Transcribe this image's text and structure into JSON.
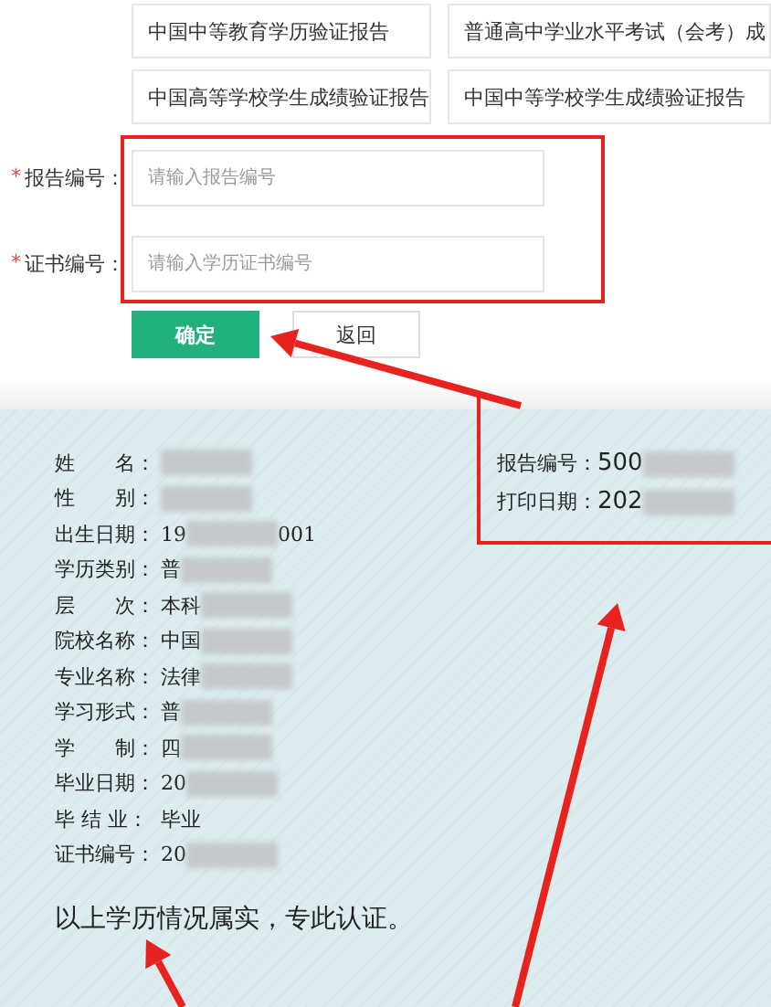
{
  "report_types": [
    {
      "label": "中国中等教育学历验证报告"
    },
    {
      "label": "普通高中学业水平考试（会考）成"
    },
    {
      "label": "中国高等学校学生成绩验证报告"
    },
    {
      "label": "中国中等学校学生成绩验证报告"
    }
  ],
  "fields": [
    {
      "label": "报告编号：",
      "placeholder": "请输入报告编号",
      "marker": "*"
    },
    {
      "label": "证书编号：",
      "placeholder": "请输入学历证书编号",
      "marker": "*"
    }
  ],
  "buttons": [
    {
      "label": "确定",
      "kind": "primary"
    },
    {
      "label": "返回",
      "kind": "default"
    }
  ],
  "certificate": {
    "header": [
      {
        "label": "报告编号：",
        "value": "500",
        "redacted": true
      },
      {
        "label": "打印日期：",
        "value": "202",
        "redacted": true
      }
    ],
    "rows": [
      {
        "label": "姓　　名：",
        "redacted": true
      },
      {
        "label": "性　　别：",
        "redacted": true
      },
      {
        "label": "出生日期：",
        "value": "19",
        "redacted": true,
        "value_end": "001"
      },
      {
        "label": "学历类别：",
        "value": "普",
        "redacted": true
      },
      {
        "label": "层　　次：",
        "value": "本科",
        "redacted": true
      },
      {
        "label": "院校名称：",
        "value": "中国",
        "redacted": true
      },
      {
        "label": "专业名称：",
        "value": "法律",
        "redacted": true
      },
      {
        "label": "学习形式：",
        "value": "普",
        "redacted": true
      },
      {
        "label": "学　　制：",
        "value": "四",
        "redacted": true
      },
      {
        "label": "毕业日期：",
        "value": "20",
        "redacted": true
      },
      {
        "label": "毕 结 业：",
        "value": "毕业",
        "redacted": false
      },
      {
        "label": "证书编号：",
        "value": "20",
        "redacted": true
      }
    ],
    "statement": "以上学历情况属实，专此认证。"
  }
}
